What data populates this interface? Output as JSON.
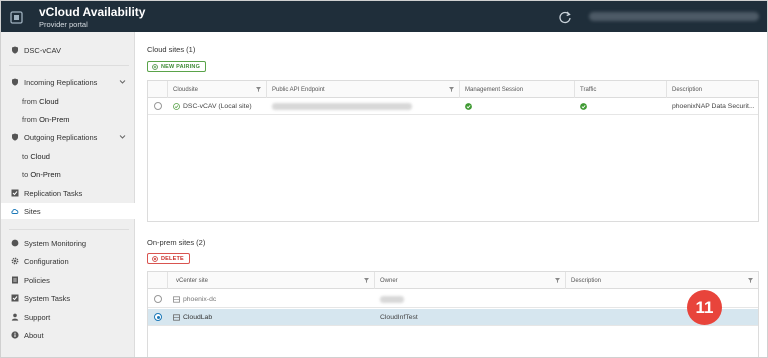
{
  "header": {
    "title": "vCloud Availability",
    "subtitle": "Provider portal"
  },
  "sidebar": {
    "items": [
      {
        "label": "DSC-vCAV"
      },
      {
        "label": "Incoming Replications"
      },
      {
        "prefix": "from ",
        "label": "Cloud"
      },
      {
        "prefix": "from ",
        "label": "On-Prem"
      },
      {
        "label": "Outgoing Replications"
      },
      {
        "prefix": "to ",
        "label": "Cloud"
      },
      {
        "prefix": "to ",
        "label": "On-Prem"
      },
      {
        "label": "Replication Tasks"
      },
      {
        "label": "Sites"
      },
      {
        "label": "System Monitoring"
      },
      {
        "label": "Configuration"
      },
      {
        "label": "Policies"
      },
      {
        "label": "System Tasks"
      },
      {
        "label": "Support"
      },
      {
        "label": "About"
      }
    ]
  },
  "cloud_sites": {
    "title": "Cloud sites (1)",
    "new_pairing_label": "NEW PAIRING",
    "columns": [
      "Cloudsite",
      "Public API Endpoint",
      "Management Session",
      "Traffic",
      "Description"
    ],
    "rows": [
      {
        "site": "DSC-vCAV (Local site)",
        "description": "phoenixNAP Data Securit..."
      }
    ]
  },
  "onprem_sites": {
    "title": "On-prem sites (2)",
    "delete_label": "DELETE",
    "columns": [
      "vCenter site",
      "Owner",
      "Description"
    ],
    "rows": [
      {
        "site": "phoenix-dc",
        "owner": "",
        "description": ""
      },
      {
        "site": "CloudLab",
        "owner": "CloudInfTest",
        "description": ""
      }
    ]
  },
  "callout": {
    "number": "11"
  },
  "colors": {
    "header_bg": "#1f2e3a",
    "accent_green": "#5aa34a",
    "accent_red": "#d9534f",
    "selected_row": "#d6e6ef",
    "callout": "#e8443b"
  }
}
